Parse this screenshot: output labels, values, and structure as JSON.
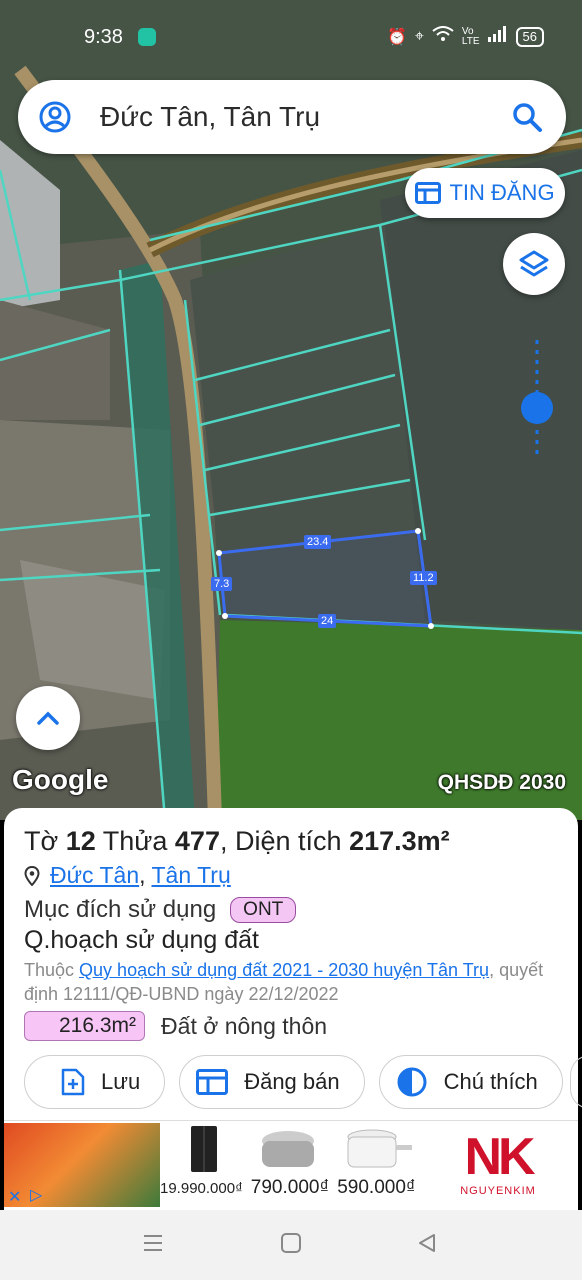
{
  "status_bar": {
    "time": "9:38",
    "battery": "56",
    "network_label": "Vo\nLTE"
  },
  "search": {
    "query": "Đức Tân, Tân Trụ"
  },
  "map": {
    "tin_dang_label": "TIN ĐĂNG",
    "google_label": "Google",
    "plan_code": "QHSDĐ 2030",
    "edge_labels": [
      "23.4",
      "7.3",
      "11.2",
      "24"
    ]
  },
  "parcel": {
    "to_label": "Tờ",
    "to_value": "12",
    "thua_label": "Thửa",
    "thua_value": "477",
    "area_label": "Diện tích",
    "area_value": "217.3m²",
    "commune_link": "Đức Tân",
    "district_link": "Tân Trụ",
    "usage_label": "Mục đích sử dụng",
    "usage_code": "ONT",
    "plan_title": "Q.hoạch sử dụng đất",
    "belong_prefix": "Thuộc",
    "plan_link": "Quy hoạch sử dụng đất 2021 - 2030 huyện Tân Trụ",
    "decision_text": ", quyết định 12111/QĐ-UBND ngày 22/12/2022",
    "planned_area": "216.3m²",
    "planned_usage": "Đất ở nông thôn"
  },
  "actions": {
    "save": "Lưu",
    "sell": "Đăng bán",
    "legend": "Chú thích"
  },
  "ad": {
    "price_1": "19.990.000₫",
    "price_2": "790.000₫",
    "price_3": "590.000₫",
    "logo_text": "NK",
    "brand": "NGUYENKIM"
  },
  "colors": {
    "accent": "#1a73e8",
    "parcel_line": "#3b6cf0",
    "plan_lines": "#4fd6c2",
    "badge": "#f4c6f4",
    "nk_red": "#d0112b"
  }
}
